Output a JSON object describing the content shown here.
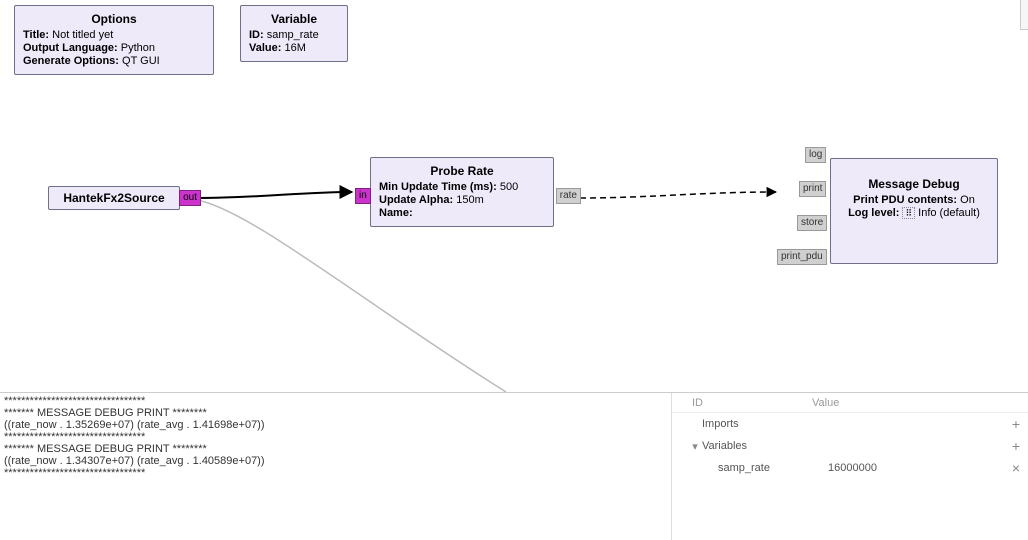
{
  "options_block": {
    "title": "Options",
    "rows": [
      {
        "k": "Title:",
        "v": "Not titled yet"
      },
      {
        "k": "Output Language:",
        "v": "Python"
      },
      {
        "k": "Generate Options:",
        "v": "QT GUI"
      }
    ]
  },
  "variable_block": {
    "title": "Variable",
    "rows": [
      {
        "k": "ID:",
        "v": "samp_rate"
      },
      {
        "k": "Value:",
        "v": "16M"
      }
    ]
  },
  "hantek_block": {
    "title": "HantekFx2Source",
    "port_out": "out"
  },
  "probe_block": {
    "title": "Probe Rate",
    "rows": [
      {
        "k": "Min Update Time (ms):",
        "v": "500"
      },
      {
        "k": "Update Alpha:",
        "v": "150m"
      },
      {
        "k": "Name:",
        "v": ""
      }
    ],
    "port_in": "in",
    "port_rate": "rate"
  },
  "msgdebug_block": {
    "title": "Message Debug",
    "rows": [
      {
        "k": "Print PDU contents:",
        "v": "On"
      },
      {
        "k": "Log level:      ",
        "v": "Info (default)"
      }
    ],
    "port_log": "log",
    "port_print": "print",
    "port_store": "store",
    "port_print_pdu": "print_pdu"
  },
  "console": {
    "l1": "*********************************",
    "l2": "******* MESSAGE DEBUG PRINT ********",
    "l3": "((rate_now . 1.35269e+07) (rate_avg . 1.41698e+07))",
    "l4": "*********************************",
    "l5": "******* MESSAGE DEBUG PRINT ********",
    "l6": "((rate_now . 1.34307e+07) (rate_avg . 1.40589e+07))",
    "l7": "*********************************"
  },
  "varpanel": {
    "head_id": "ID",
    "head_val": "Value",
    "imports": "Imports",
    "variables": "Variables",
    "var_name": "samp_rate",
    "var_val": "16000000"
  }
}
